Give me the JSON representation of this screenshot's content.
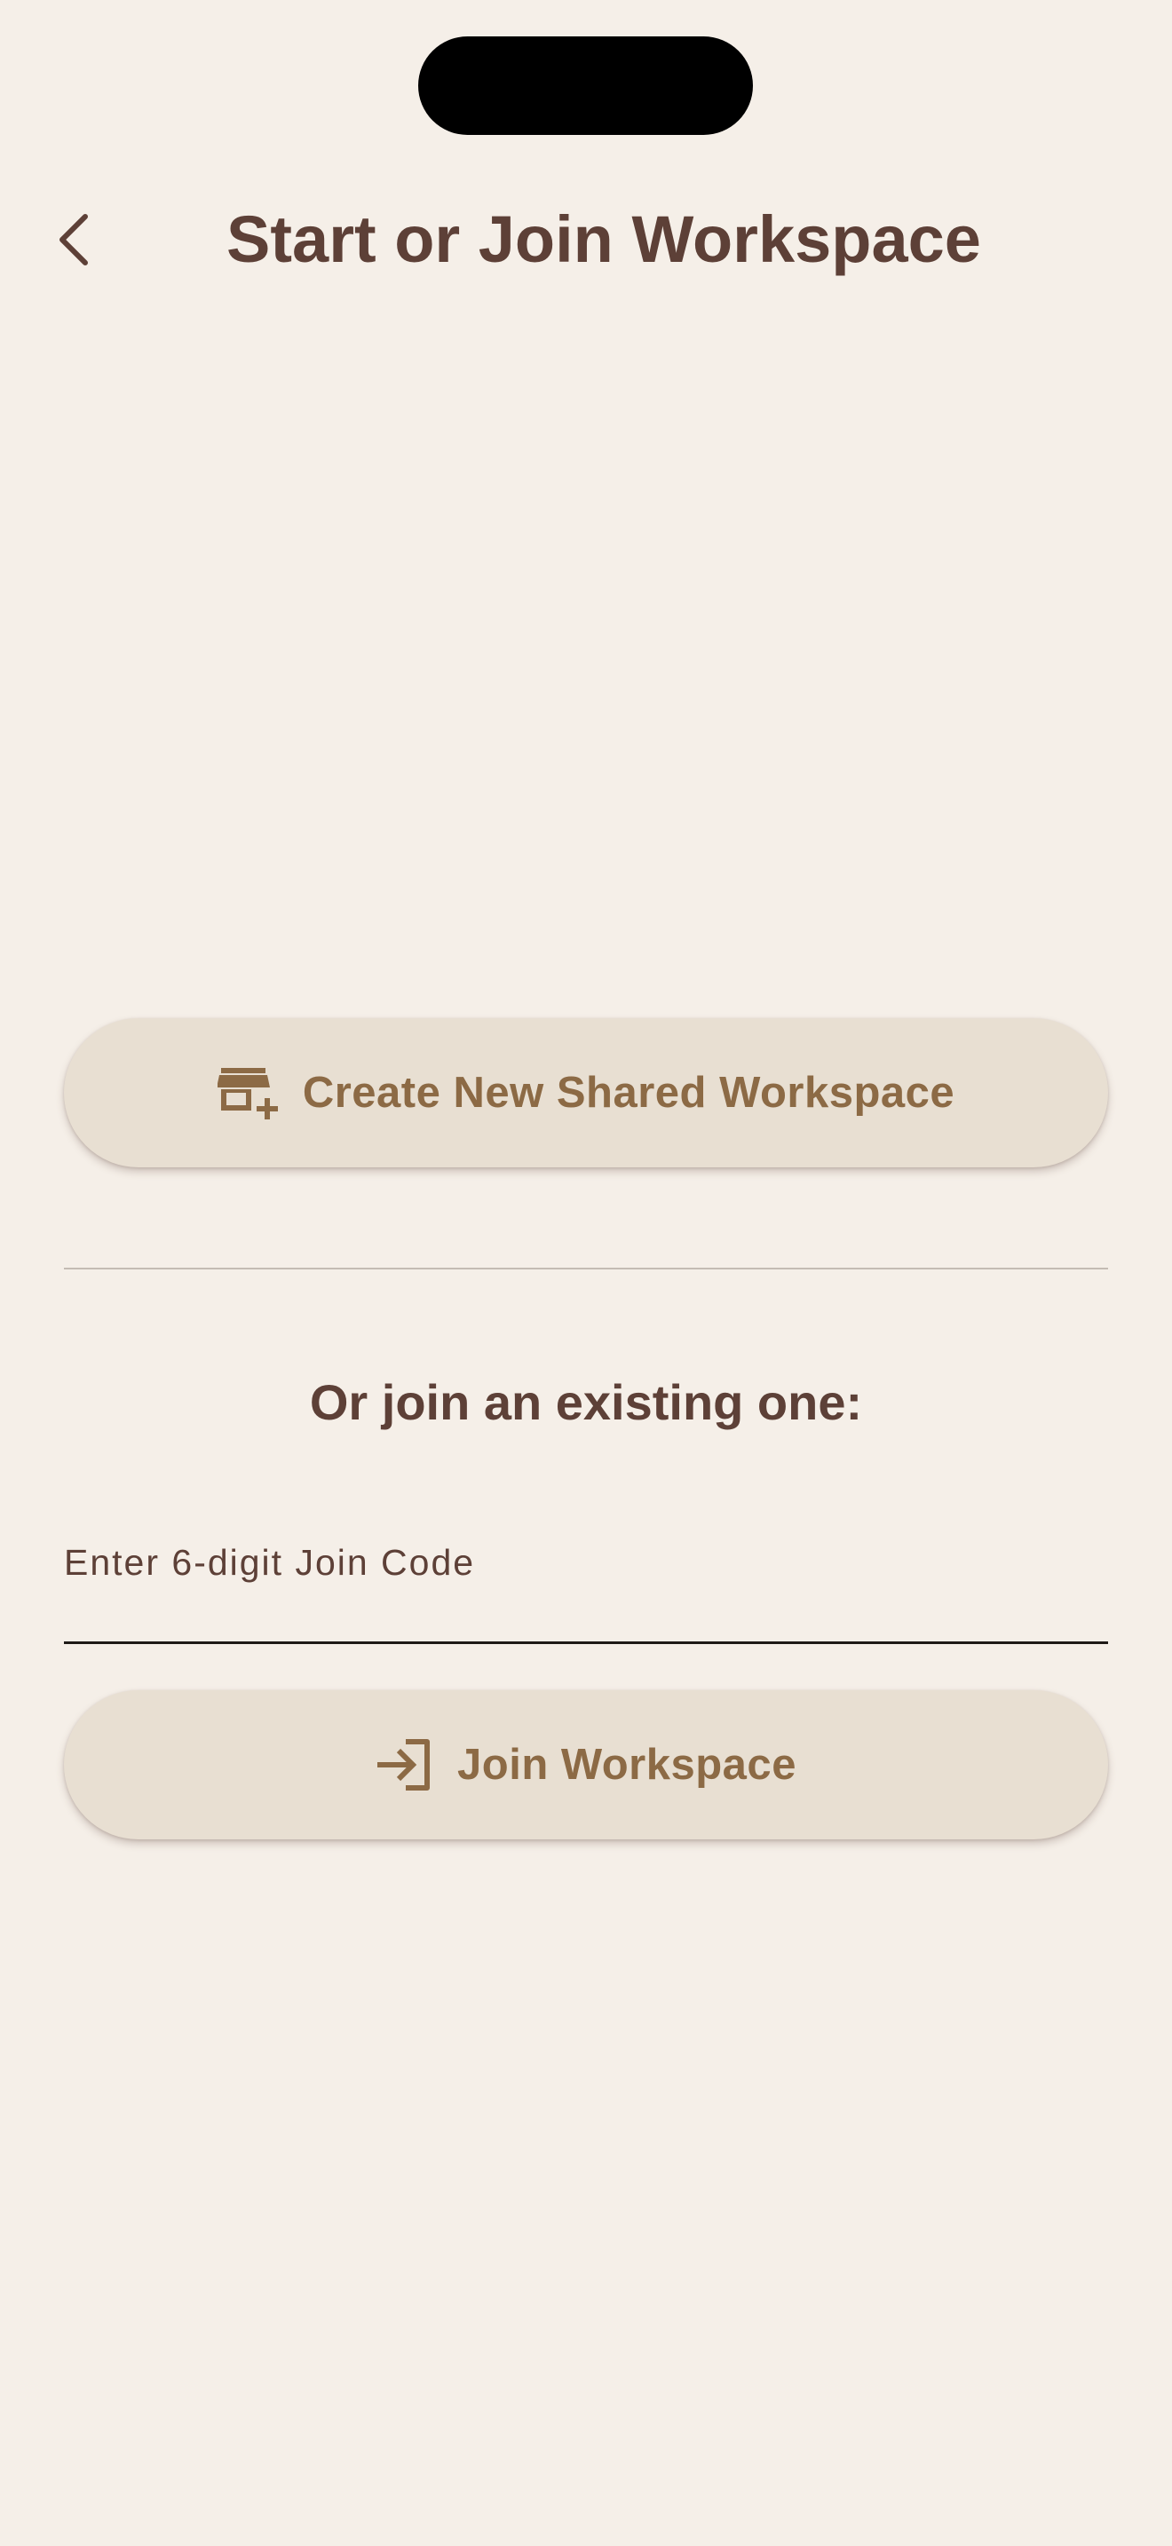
{
  "header": {
    "title": "Start or Join Workspace",
    "back_icon": "chevron-left-icon"
  },
  "create_section": {
    "button_label": "Create New Shared Workspace",
    "button_icon": "add-business-icon"
  },
  "join_section": {
    "heading": "Or join an existing one:",
    "code_input": {
      "value": "",
      "placeholder": "Enter 6-digit Join Code"
    },
    "button_label": "Join Workspace",
    "button_icon": "login-icon"
  },
  "colors": {
    "background": "#F5EFE8",
    "primary_text": "#5D4037",
    "button_background": "#E8DFD2",
    "button_text": "#8C6A45",
    "divider": "#C4BCB4"
  }
}
